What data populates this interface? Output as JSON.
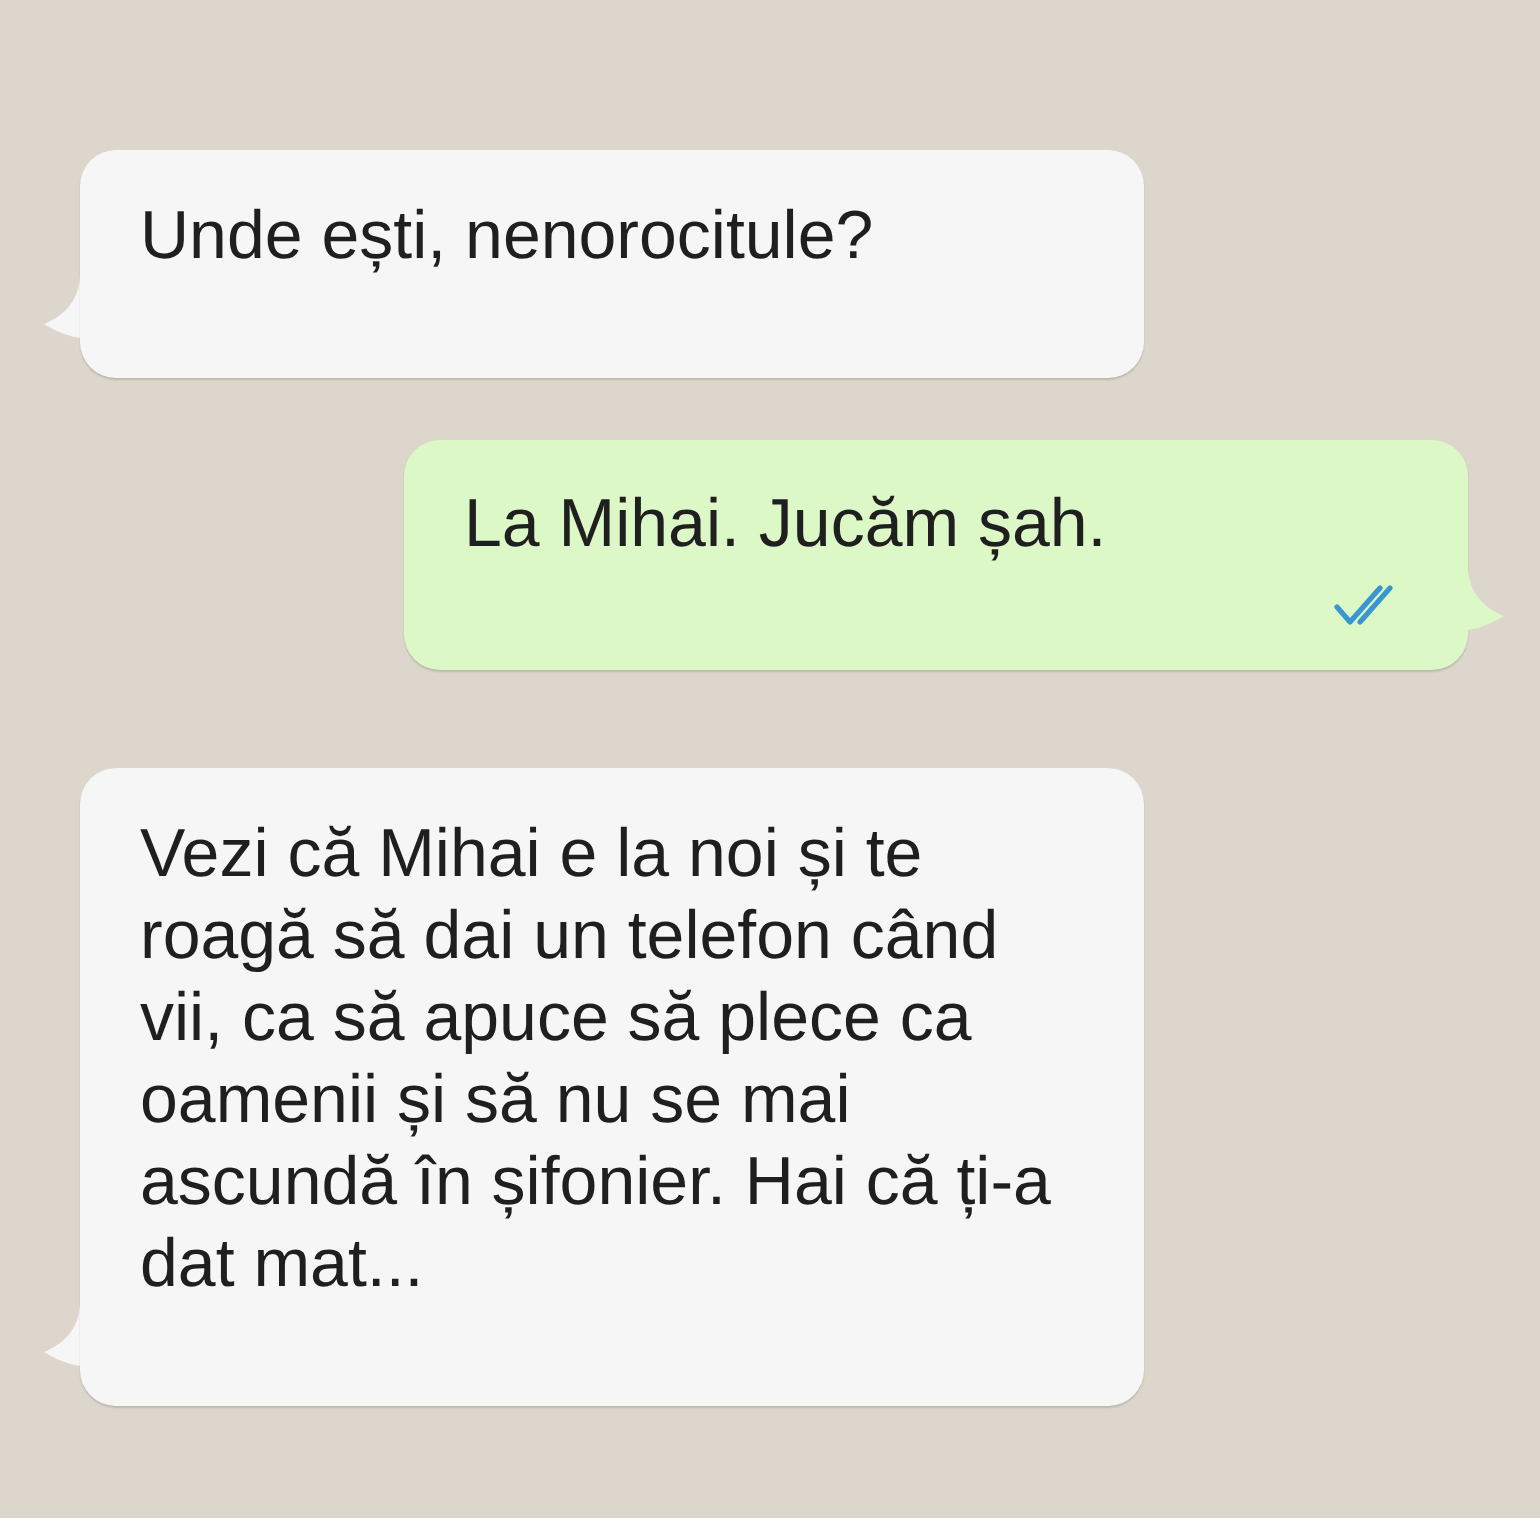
{
  "messages": [
    {
      "kind": "incoming",
      "text": "Unde ești, nenorocitule?"
    },
    {
      "kind": "outgoing",
      "text": "La Mihai. Jucăm șah.",
      "read": true
    },
    {
      "kind": "incoming",
      "text": "Vezi că Mihai e la noi și te roagă să dai un telefon când vii, ca să apuce să plece ca oamenii și să nu se mai ascundă în șifonier. Hai că ți-a dat mat..."
    }
  ]
}
